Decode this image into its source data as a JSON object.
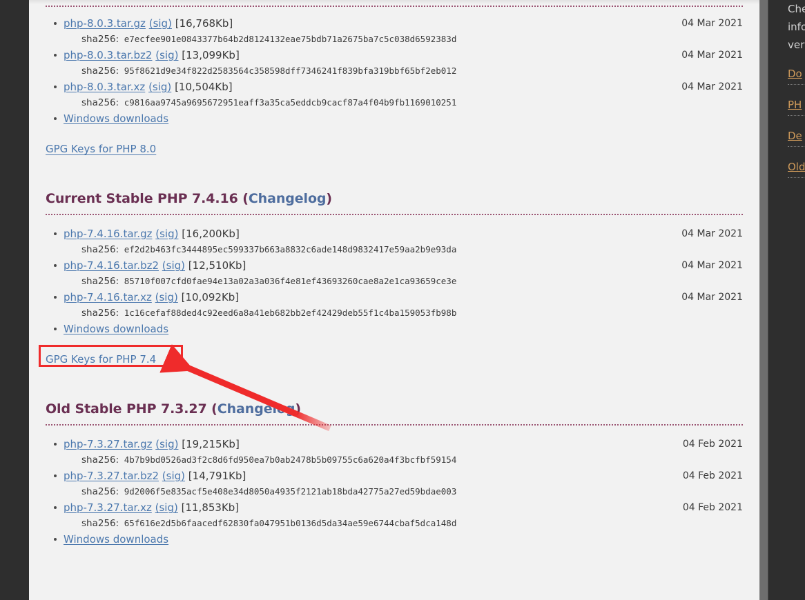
{
  "page": {
    "background_color": "#f2f2f2",
    "chrome_color": "#303030",
    "heading_color": "#6a2f52",
    "link_color": "#4a77ad",
    "annotation_color": "#ef2b2b"
  },
  "sections": [
    {
      "id": "php80",
      "title_visible": false,
      "title": "",
      "changelog_label": "",
      "files": [
        {
          "name": "php-8.0.3.tar.gz",
          "sig_label": "(sig)",
          "size": "[16,768Kb]",
          "date": "04 Mar 2021",
          "sha_label": "sha256:",
          "sha": "e7ecfee901e0843377b64b2d8124132eae75bdb71a2675ba7c5c038d6592383d"
        },
        {
          "name": "php-8.0.3.tar.bz2",
          "sig_label": "(sig)",
          "size": "[13,099Kb]",
          "date": "04 Mar 2021",
          "sha_label": "sha256:",
          "sha": "95f8621d9e34f822d2583564c358598dff7346241f839bfa319bbf65bf2eb012"
        },
        {
          "name": "php-8.0.3.tar.xz",
          "sig_label": "(sig)",
          "size": "[10,504Kb]",
          "date": "04 Mar 2021",
          "sha_label": "sha256:",
          "sha": "c9816aa9745a9695672951eaff3a35ca5eddcb9cacf87a4f04b9fb1169010251"
        }
      ],
      "windows_label": "Windows downloads",
      "gpg_label": "GPG Keys for PHP 8.0"
    },
    {
      "id": "php74",
      "title_visible": true,
      "title": "Current Stable PHP 7.4.16",
      "changelog_label": "Changelog",
      "files": [
        {
          "name": "php-7.4.16.tar.gz",
          "sig_label": "(sig)",
          "size": "[16,200Kb]",
          "date": "04 Mar 2021",
          "sha_label": "sha256:",
          "sha": "ef2d2b463fc3444895ec599337b663a8832c6ade148d9832417e59aa2b9e93da"
        },
        {
          "name": "php-7.4.16.tar.bz2",
          "sig_label": "(sig)",
          "size": "[12,510Kb]",
          "date": "04 Mar 2021",
          "sha_label": "sha256:",
          "sha": "85710f007cfd0fae94e13a02a3a036f4e81ef43693260cae8a2e1ca93659ce3e"
        },
        {
          "name": "php-7.4.16.tar.xz",
          "sig_label": "(sig)",
          "size": "[10,092Kb]",
          "date": "04 Mar 2021",
          "sha_label": "sha256:",
          "sha": "1c16cefaf88ded4c92eed6a8a41eb682bb2ef42429deb55f1c4ba159053fb98b"
        }
      ],
      "windows_label": "Windows downloads",
      "gpg_label": "GPG Keys for PHP 7.4"
    },
    {
      "id": "php73",
      "title_visible": true,
      "title": "Old Stable PHP 7.3.27",
      "changelog_label": "Changelog",
      "files": [
        {
          "name": "php-7.3.27.tar.gz",
          "sig_label": "(sig)",
          "size": "[19,215Kb]",
          "date": "04 Feb 2021",
          "sha_label": "sha256:",
          "sha": "4b7b9bd0526ad3f2c8d6fd950ea7b0ab2478b5b09755c6a620a4f3bcfbf59154"
        },
        {
          "name": "php-7.3.27.tar.bz2",
          "sig_label": "(sig)",
          "size": "[14,791Kb]",
          "date": "04 Feb 2021",
          "sha_label": "sha256:",
          "sha": "9d2006f5e835acf5e408e34d8050a4935f2121ab18bda42775a27ed59bdae003"
        },
        {
          "name": "php-7.3.27.tar.xz",
          "sig_label": "(sig)",
          "size": "[11,853Kb]",
          "date": "04 Feb 2021",
          "sha_label": "sha256:",
          "sha": "65f616e2d5b6faacedf62830fa047951b0136d5da34ae59e6744cbaf5dca148d"
        }
      ],
      "windows_label": "Windows downloads",
      "gpg_label": ""
    }
  ],
  "sidebar": {
    "paragraph_lines": [
      "Che",
      "info",
      "ver"
    ],
    "links": [
      "Do",
      "PH",
      "De",
      "Old"
    ]
  },
  "annotation": {
    "box_target": "Windows downloads",
    "arrow_color": "#ef2b2b"
  }
}
